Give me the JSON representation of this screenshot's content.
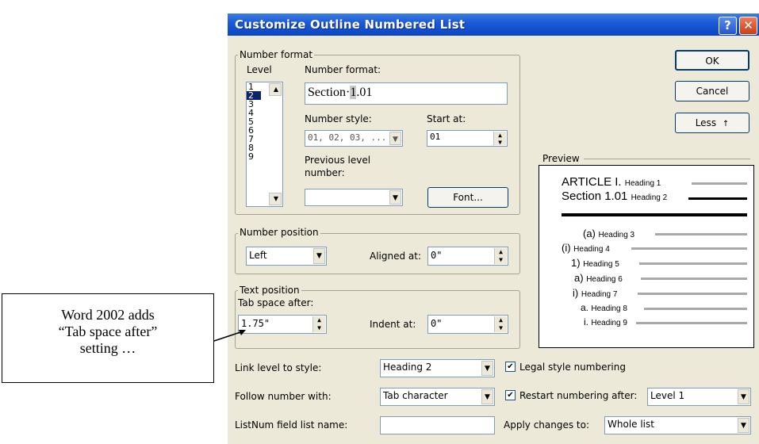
{
  "dialog": {
    "title": "Customize Outline Numbered List",
    "help_glyph": "?",
    "close_glyph": "✕"
  },
  "number_format": {
    "group_label": "Number format",
    "level_label": "Level",
    "levels": [
      "1",
      "2",
      "3",
      "4",
      "5",
      "6",
      "7",
      "8",
      "9"
    ],
    "selected_level": "2",
    "format_label": "Number format:",
    "format_value_prefix": "Section·",
    "format_value_selected": "1",
    "format_value_suffix": ".01",
    "style_label": "Number style:",
    "style_value": "01, 02, 03, ...",
    "start_label": "Start at:",
    "start_value": "01",
    "prev_level_label_1": "Previous level",
    "prev_level_label_2": "number:",
    "prev_level_value": "",
    "font_button": "Font..."
  },
  "number_position": {
    "group_label": "Number position",
    "align_value": "Left",
    "aligned_at_label": "Aligned at:",
    "aligned_at_value": "0\""
  },
  "text_position": {
    "group_label": "Text position",
    "tab_space_label": "Tab space after:",
    "tab_space_value": "1.75\"",
    "indent_label": "Indent at:",
    "indent_value": "0\""
  },
  "buttons": {
    "ok": "OK",
    "cancel": "Cancel",
    "less": "Less",
    "less_glyph": "↑"
  },
  "preview": {
    "label": "Preview",
    "lines": [
      {
        "num": "ARTICLE I.",
        "text": "Heading 1"
      },
      {
        "num": "Section 1.01",
        "text": "Heading 2"
      },
      {
        "num": "(a)",
        "text": "Heading 3"
      },
      {
        "num": "(i)",
        "text": "Heading 4"
      },
      {
        "num": "1)",
        "text": "Heading 5"
      },
      {
        "num": "a)",
        "text": "Heading 6"
      },
      {
        "num": "i)",
        "text": "Heading 7"
      },
      {
        "num": "a.",
        "text": "Heading 8"
      },
      {
        "num": "i.",
        "text": "Heading 9"
      }
    ]
  },
  "bottom": {
    "link_label": "Link level to style:",
    "link_value": "Heading 2",
    "legal_label": "Legal style numbering",
    "legal_checked": true,
    "follow_label": "Follow number with:",
    "follow_value": "Tab character",
    "restart_label": "Restart numbering after:",
    "restart_checked": true,
    "restart_value": "Level 1",
    "listnum_label": "ListNum field list name:",
    "listnum_value": "",
    "apply_label": "Apply changes to:",
    "apply_value": "Whole list"
  },
  "callout": {
    "line1": "Word 2002 adds",
    "line2": "“Tab space after”",
    "line3": "setting …"
  }
}
